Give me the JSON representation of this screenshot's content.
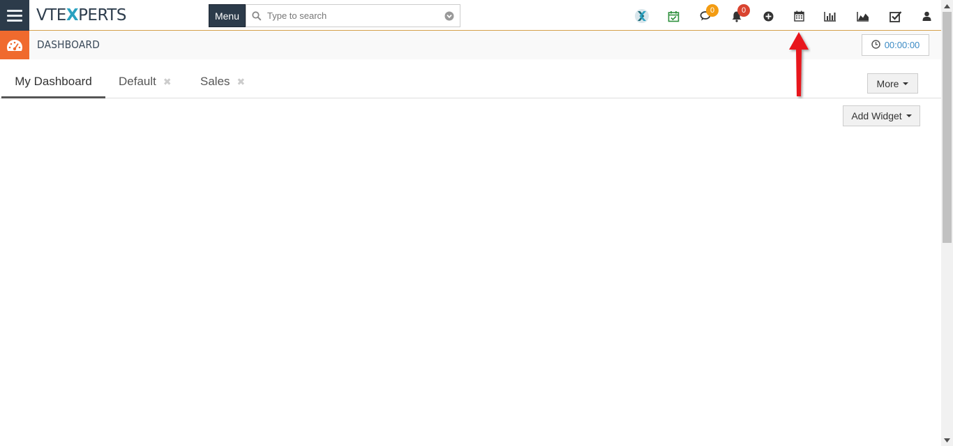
{
  "topbar": {
    "logo_prefix": "VTE",
    "logo_x": "X",
    "logo_suffix": "PERTS",
    "menu_label": "Menu",
    "search_placeholder": "Type to search",
    "chat_badge": "0",
    "notifications_badge": "0"
  },
  "module": {
    "title": "DASHBOARD",
    "timer": "00:00:00"
  },
  "tabs": [
    {
      "label": "My Dashboard",
      "active": true
    },
    {
      "label": "Default",
      "closable": true
    },
    {
      "label": "Sales",
      "closable": true
    }
  ],
  "actions": {
    "more_label": "More",
    "add_widget_label": "Add Widget"
  },
  "colors": {
    "nav_dark": "#2c3b4a",
    "module_accent": "#f06a2e",
    "badge_orange": "#f39c12",
    "badge_red": "#d9432f",
    "timer_blue": "#3a8ac4",
    "annotation_arrow": "#e8141b"
  },
  "icons": [
    "hamburger-icon",
    "search-icon",
    "dropdown-icon",
    "vtexperts-x-icon",
    "calendar-check-icon",
    "chat-icon",
    "bell-icon",
    "plus-circle-icon",
    "calendar-icon",
    "bar-chart-icon",
    "area-chart-icon",
    "checkbox-icon",
    "user-icon",
    "dashboard-gauge-icon",
    "clock-icon"
  ]
}
